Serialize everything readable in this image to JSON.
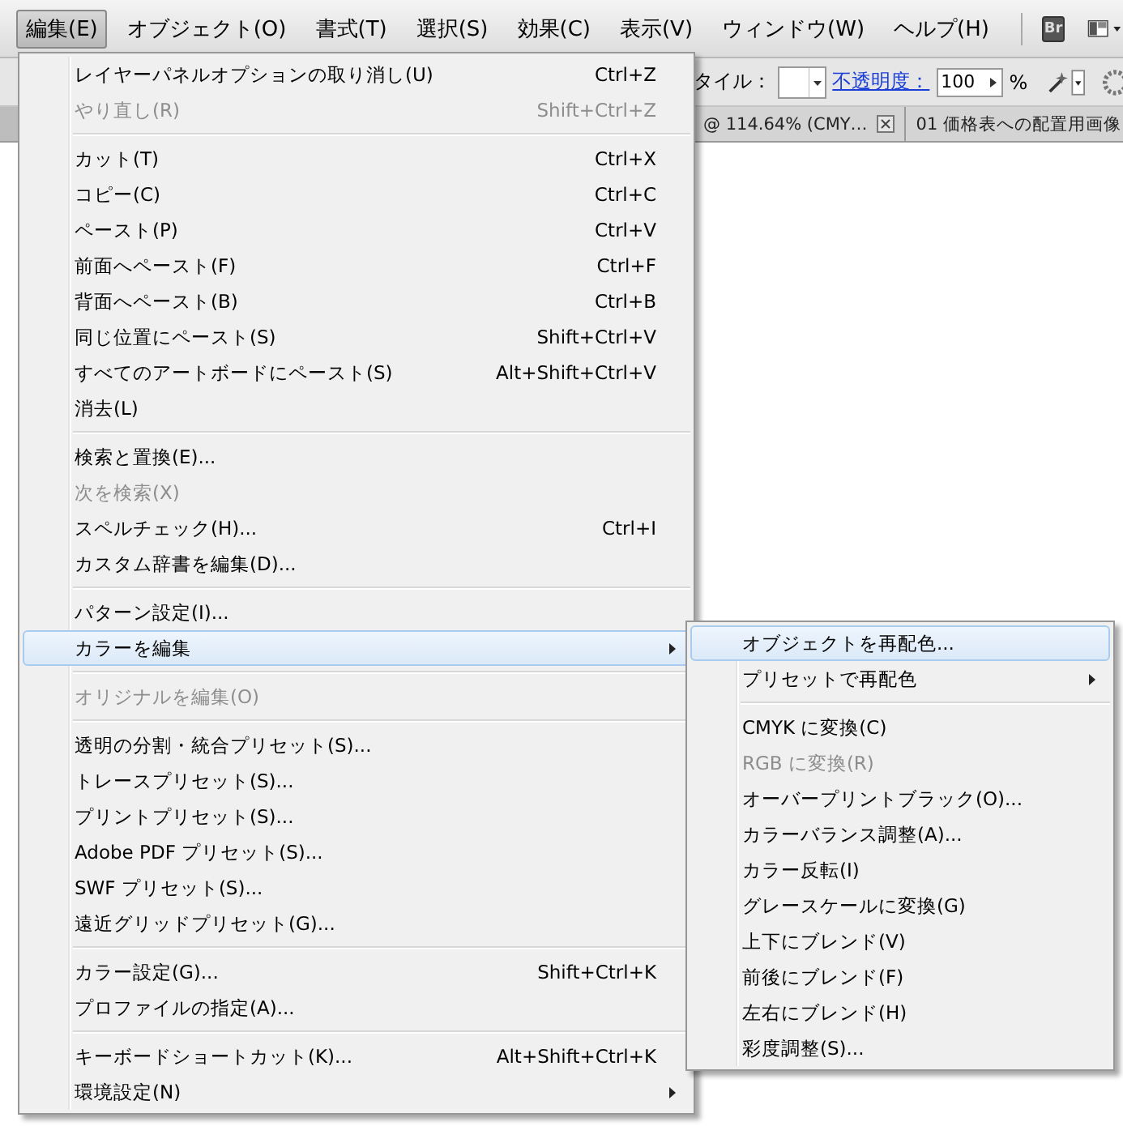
{
  "menubar": {
    "items": [
      {
        "label": "編集(E)",
        "selected": true
      },
      {
        "label": "オブジェクト(O)",
        "selected": false
      },
      {
        "label": "書式(T)",
        "selected": false
      },
      {
        "label": "選択(S)",
        "selected": false
      },
      {
        "label": "効果(C)",
        "selected": false
      },
      {
        "label": "表示(V)",
        "selected": false
      },
      {
        "label": "ウィンドウ(W)",
        "selected": false
      },
      {
        "label": "ヘルプ(H)",
        "selected": false
      }
    ],
    "bridge_button": "Br"
  },
  "control_bar": {
    "style_label": "タイル：",
    "opacity_link": "不透明度：",
    "opacity_value": "100",
    "percent": "%"
  },
  "document_tabs": [
    {
      "label": "@ 114.64% (CMY…",
      "closable": true
    },
    {
      "label": "01 価格表への配置用画像",
      "closable": false
    }
  ],
  "edit_menu": {
    "items": [
      {
        "kind": "item",
        "label": "レイヤーパネルオプションの取り消し(U)",
        "shortcut": "Ctrl+Z",
        "disabled": false,
        "selected": false,
        "has_submenu": false
      },
      {
        "kind": "item",
        "label": "やり直し(R)",
        "shortcut": "Shift+Ctrl+Z",
        "disabled": true,
        "selected": false,
        "has_submenu": false
      },
      {
        "kind": "separator"
      },
      {
        "kind": "item",
        "label": "カット(T)",
        "shortcut": "Ctrl+X",
        "disabled": false,
        "selected": false,
        "has_submenu": false
      },
      {
        "kind": "item",
        "label": "コピー(C)",
        "shortcut": "Ctrl+C",
        "disabled": false,
        "selected": false,
        "has_submenu": false
      },
      {
        "kind": "item",
        "label": "ペースト(P)",
        "shortcut": "Ctrl+V",
        "disabled": false,
        "selected": false,
        "has_submenu": false
      },
      {
        "kind": "item",
        "label": "前面へペースト(F)",
        "shortcut": "Ctrl+F",
        "disabled": false,
        "selected": false,
        "has_submenu": false
      },
      {
        "kind": "item",
        "label": "背面へペースト(B)",
        "shortcut": "Ctrl+B",
        "disabled": false,
        "selected": false,
        "has_submenu": false
      },
      {
        "kind": "item",
        "label": "同じ位置にペースト(S)",
        "shortcut": "Shift+Ctrl+V",
        "disabled": false,
        "selected": false,
        "has_submenu": false
      },
      {
        "kind": "item",
        "label": "すべてのアートボードにペースト(S)",
        "shortcut": "Alt+Shift+Ctrl+V",
        "disabled": false,
        "selected": false,
        "has_submenu": false
      },
      {
        "kind": "item",
        "label": "消去(L)",
        "disabled": false,
        "selected": false,
        "has_submenu": false
      },
      {
        "kind": "separator"
      },
      {
        "kind": "item",
        "label": "検索と置換(E)...",
        "disabled": false,
        "selected": false,
        "has_submenu": false
      },
      {
        "kind": "item",
        "label": "次を検索(X)",
        "disabled": true,
        "selected": false,
        "has_submenu": false
      },
      {
        "kind": "item",
        "label": "スペルチェック(H)...",
        "shortcut": "Ctrl+I",
        "disabled": false,
        "selected": false,
        "has_submenu": false
      },
      {
        "kind": "item",
        "label": "カスタム辞書を編集(D)...",
        "disabled": false,
        "selected": false,
        "has_submenu": false
      },
      {
        "kind": "separator"
      },
      {
        "kind": "item",
        "label": "パターン設定(I)...",
        "disabled": false,
        "selected": false,
        "has_submenu": false
      },
      {
        "kind": "item",
        "label": "カラーを編集",
        "disabled": false,
        "selected": true,
        "has_submenu": true
      },
      {
        "kind": "separator"
      },
      {
        "kind": "item",
        "label": "オリジナルを編集(O)",
        "disabled": true,
        "selected": false,
        "has_submenu": false
      },
      {
        "kind": "separator"
      },
      {
        "kind": "item",
        "label": "透明の分割・統合プリセット(S)...",
        "disabled": false,
        "selected": false,
        "has_submenu": false
      },
      {
        "kind": "item",
        "label": "トレースプリセット(S)...",
        "disabled": false,
        "selected": false,
        "has_submenu": false
      },
      {
        "kind": "item",
        "label": "プリントプリセット(S)...",
        "disabled": false,
        "selected": false,
        "has_submenu": false
      },
      {
        "kind": "item",
        "label": "Adobe PDF プリセット(S)...",
        "disabled": false,
        "selected": false,
        "has_submenu": false
      },
      {
        "kind": "item",
        "label": "SWF プリセット(S)...",
        "disabled": false,
        "selected": false,
        "has_submenu": false
      },
      {
        "kind": "item",
        "label": "遠近グリッドプリセット(G)...",
        "disabled": false,
        "selected": false,
        "has_submenu": false
      },
      {
        "kind": "separator"
      },
      {
        "kind": "item",
        "label": "カラー設定(G)...",
        "shortcut": "Shift+Ctrl+K",
        "disabled": false,
        "selected": false,
        "has_submenu": false
      },
      {
        "kind": "item",
        "label": "プロファイルの指定(A)...",
        "disabled": false,
        "selected": false,
        "has_submenu": false
      },
      {
        "kind": "separator"
      },
      {
        "kind": "item",
        "label": "キーボードショートカット(K)...",
        "shortcut": "Alt+Shift+Ctrl+K",
        "disabled": false,
        "selected": false,
        "has_submenu": false
      },
      {
        "kind": "item",
        "label": "環境設定(N)",
        "disabled": false,
        "selected": false,
        "has_submenu": true
      }
    ]
  },
  "color_submenu": {
    "items": [
      {
        "kind": "item",
        "label": "オブジェクトを再配色...",
        "disabled": false,
        "selected": true,
        "has_submenu": false
      },
      {
        "kind": "item",
        "label": "プリセットで再配色",
        "disabled": false,
        "selected": false,
        "has_submenu": true
      },
      {
        "kind": "separator"
      },
      {
        "kind": "item",
        "label": "CMYK に変換(C)",
        "disabled": false,
        "selected": false,
        "has_submenu": false
      },
      {
        "kind": "item",
        "label": "RGB に変換(R)",
        "disabled": true,
        "selected": false,
        "has_submenu": false
      },
      {
        "kind": "item",
        "label": "オーバープリントブラック(O)...",
        "disabled": false,
        "selected": false,
        "has_submenu": false
      },
      {
        "kind": "item",
        "label": "カラーバランス調整(A)...",
        "disabled": false,
        "selected": false,
        "has_submenu": false
      },
      {
        "kind": "item",
        "label": "カラー反転(I)",
        "disabled": false,
        "selected": false,
        "has_submenu": false
      },
      {
        "kind": "item",
        "label": "グレースケールに変換(G)",
        "disabled": false,
        "selected": false,
        "has_submenu": false
      },
      {
        "kind": "item",
        "label": "上下にブレンド(V)",
        "disabled": false,
        "selected": false,
        "has_submenu": false
      },
      {
        "kind": "item",
        "label": "前後にブレンド(F)",
        "disabled": false,
        "selected": false,
        "has_submenu": false
      },
      {
        "kind": "item",
        "label": "左右にブレンド(H)",
        "disabled": false,
        "selected": false,
        "has_submenu": false
      },
      {
        "kind": "item",
        "label": "彩度調整(S)...",
        "disabled": false,
        "selected": false,
        "has_submenu": false
      }
    ]
  }
}
